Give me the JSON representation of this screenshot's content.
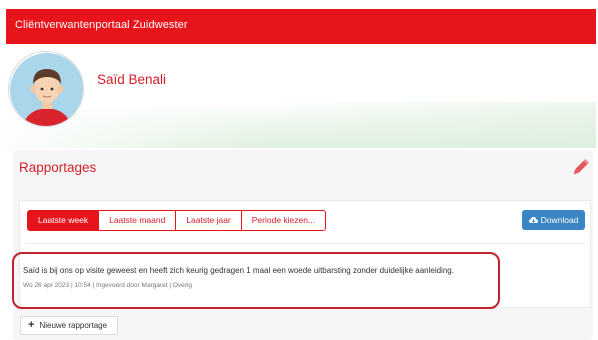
{
  "header": {
    "title": "Cliëntverwantenportaal Zuidwester"
  },
  "profile": {
    "name": "Saïd Benali",
    "avatar_icon": "person-avatar-icon"
  },
  "rapportages": {
    "title": "Rapportages",
    "edit_icon": "pencil-icon",
    "tabs": [
      {
        "label": "Laatste week",
        "active": true
      },
      {
        "label": "Laatste maand",
        "active": false
      },
      {
        "label": "Laatste jaar",
        "active": false
      },
      {
        "label": "Periode kiezen...",
        "active": false
      }
    ],
    "download_label": "Download",
    "download_icon": "cloud-download-icon",
    "entries": [
      {
        "text": "Saïd is bij ons op visite geweest en heeft zich keurig gedragen 1 maal een woede uitbarsting zonder duidelijke aanleiding.",
        "meta": "Wo 26 apr 2023 | 10:54 | Ingevoerd door Margaret | Overig"
      }
    ],
    "new_button_label": "Nieuwe rapportage"
  },
  "colors": {
    "brand_red": "#e8141b",
    "title_red": "#d3202a",
    "download_blue": "#3a86c4",
    "highlight_red": "#c0232e"
  }
}
